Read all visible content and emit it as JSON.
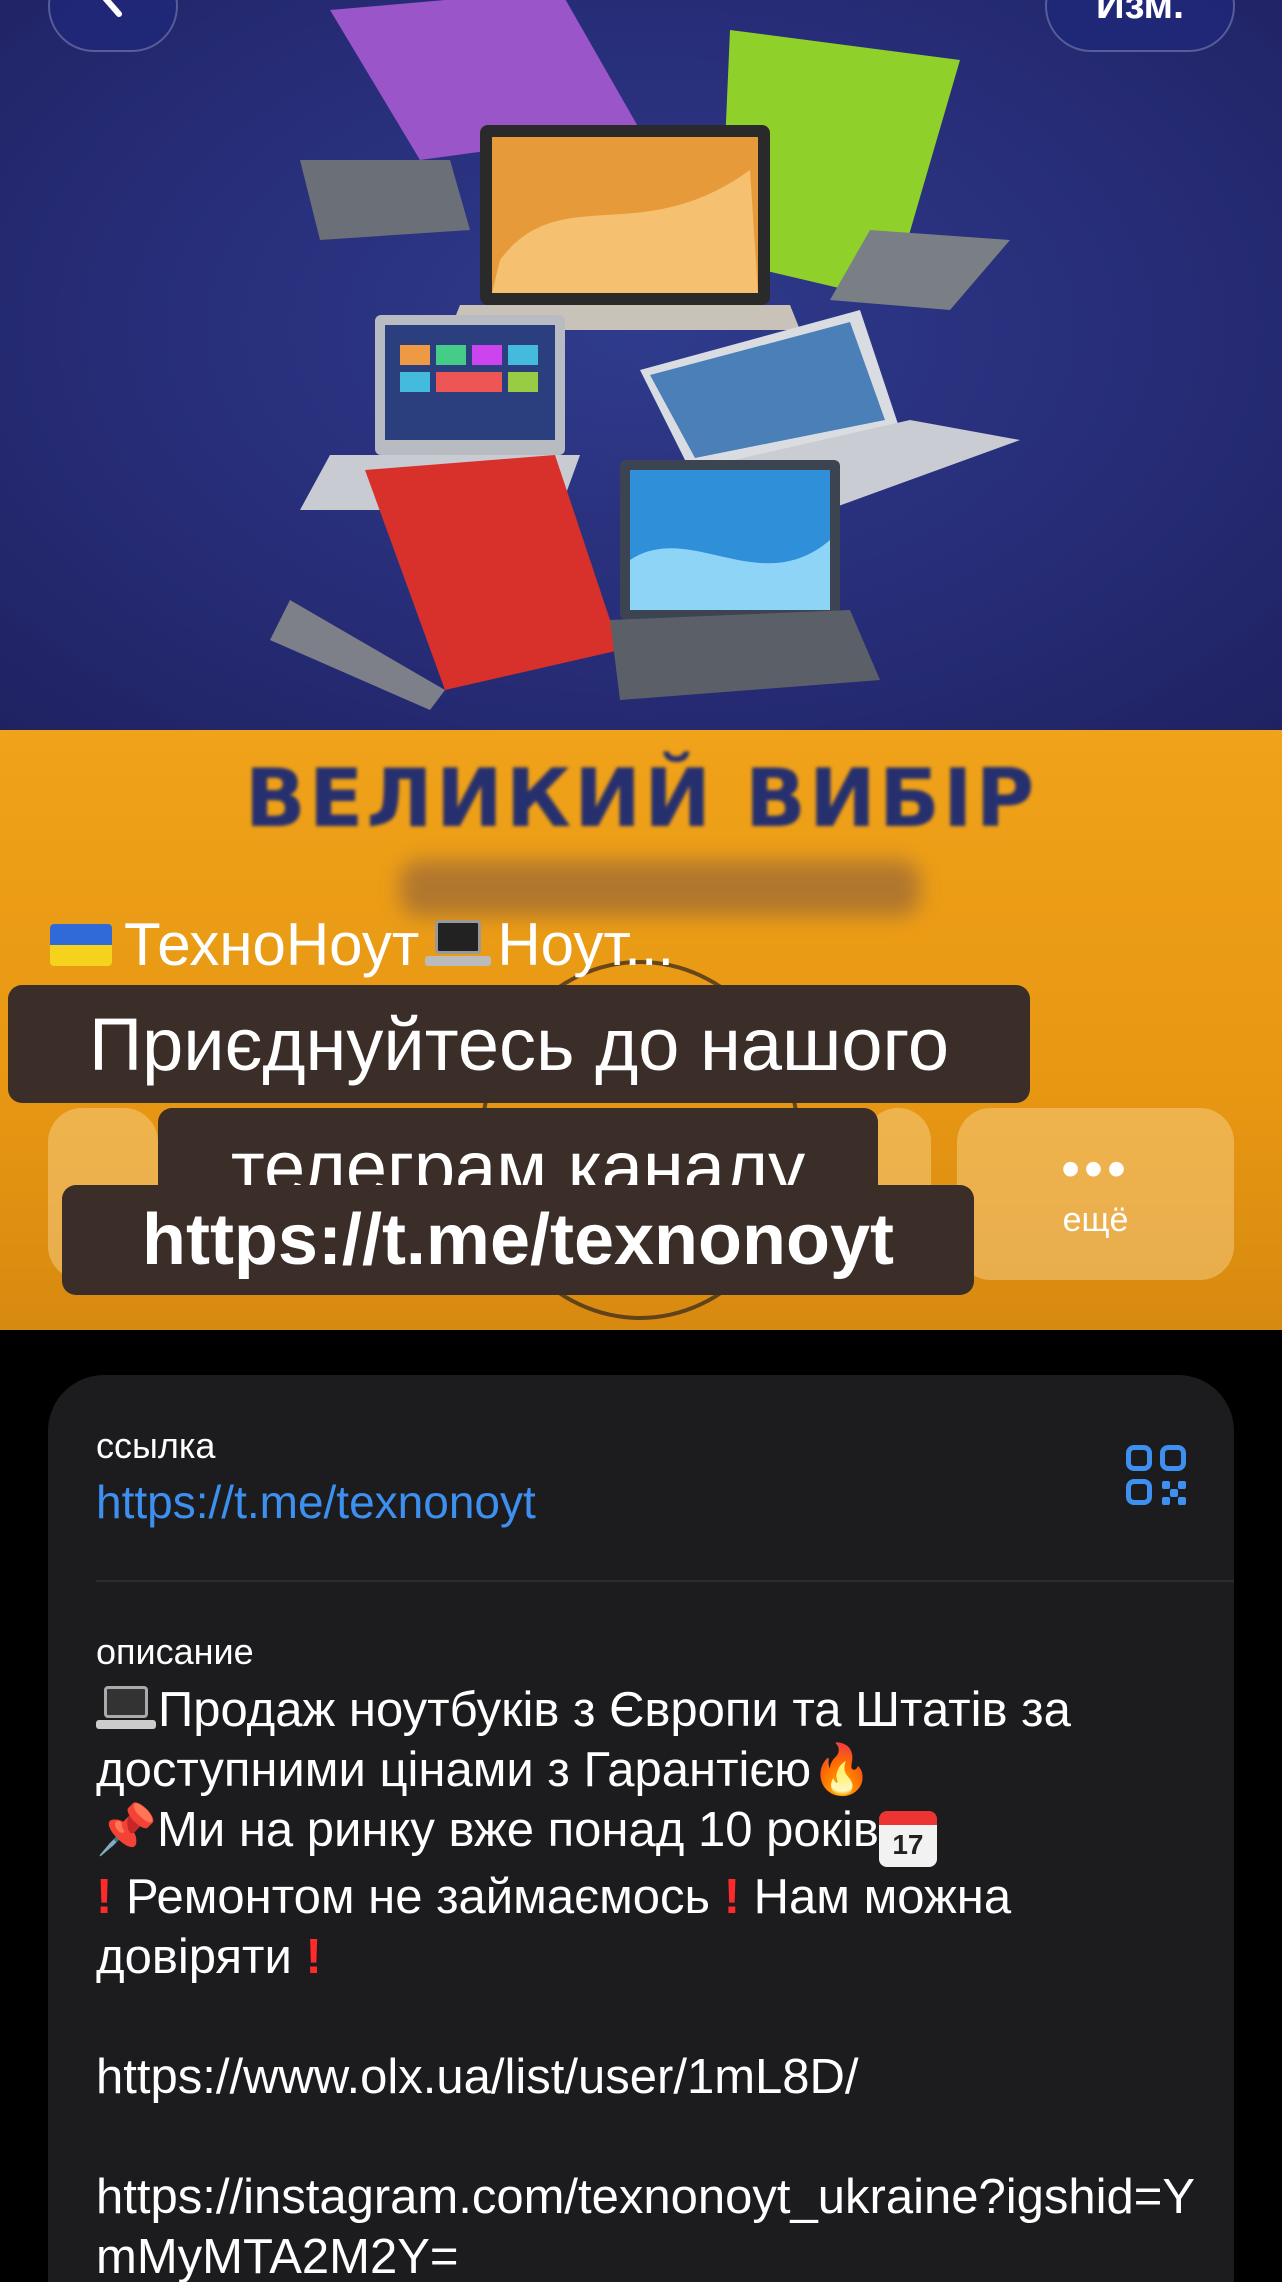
{
  "nav": {
    "back_icon": "chevron-left-icon",
    "edit_label": "Изм."
  },
  "banner": {
    "headline": "ВЕЛИКИЙ ВИБІР"
  },
  "channel": {
    "title": "ТехноНоут",
    "title_suffix": "Ноут..."
  },
  "actions": {
    "more_label": "ещё"
  },
  "caption": {
    "line1": "Приєднуйтесь до нашого",
    "line2": "телеграм каналу",
    "line3": "https://t.me/texnonoyt"
  },
  "info": {
    "link_label": "ссылка",
    "link_value": "https://t.me/texnonoyt",
    "description_label": "описание",
    "desc_line1": "Продаж ноутбуків з Європи та Штатів за доступними цінами з Гарантією",
    "desc_line2": "Ми на ринку вже понад 10 років",
    "desc_line3a": " Ремонтом не займаємось",
    "desc_line3b": " Нам можна довіряти",
    "desc_link_olx": "https://www.olx.ua/list/user/1mL8D/",
    "desc_link_instagram": "https://instagram.com/texnonoyt_ukraine?igshid=YmMyMTA2M2Y="
  },
  "colors": {
    "accent_link": "#3d8ff0",
    "card_bg": "#1c1c1e",
    "banner_blue": "#272d78",
    "banner_orange": "#f0a21a",
    "caption_bg": "#3b2d27"
  }
}
